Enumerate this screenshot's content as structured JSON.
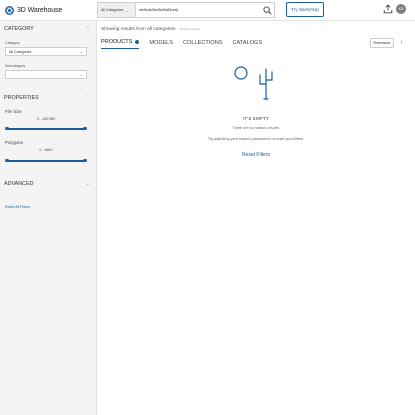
{
  "header": {
    "logo_text": "3D Warehouse",
    "category_select": "All Categories",
    "search_value": "me0s4s2bm9c2fs83zerij",
    "try_button": "Try SketchUp",
    "avatar_initials": "KS"
  },
  "sidebar": {
    "category_heading": "CATEGORY",
    "category_label": "Category",
    "category_value": "All Categories",
    "subcategory_label": "Subcategory",
    "subcategory_value": "",
    "properties_heading": "PROPERTIES",
    "file_size_label": "File Size",
    "file_size_range": "0 - 150 MB",
    "file_size_min": 0,
    "file_size_max": 1,
    "polygons_label": "Polygons",
    "polygons_range": "0 - MAX",
    "polygons_min": 0,
    "polygons_max": 1,
    "advanced_heading": "ADVANCED",
    "reset_all": "Reset All Filters"
  },
  "main": {
    "results_text": "Showing results from all categories",
    "results_count": "(0 items found)",
    "tabs": [
      {
        "label": "PRODUCTS"
      },
      {
        "label": "MODELS"
      },
      {
        "label": "COLLECTIONS"
      },
      {
        "label": "CATALOGS"
      }
    ],
    "sort_label": "Relevance",
    "empty_title": "IT'S EMPTY",
    "empty_msg1": "There are no search results.",
    "empty_msg2": "Try adjusting your search parameters or reset your filters.",
    "empty_reset": "Reset Filters"
  },
  "colors": {
    "accent": "#1b5e9b",
    "sidebar_bg": "#f4f4f4"
  }
}
